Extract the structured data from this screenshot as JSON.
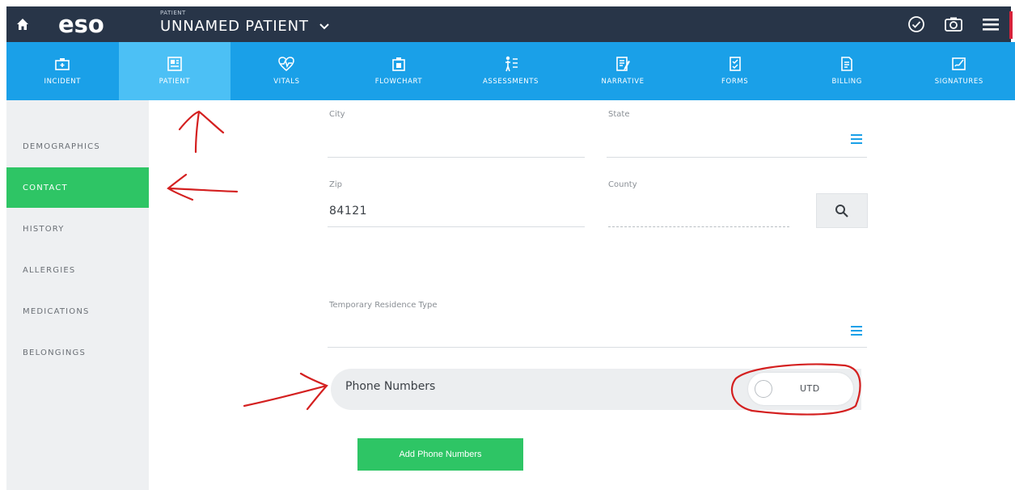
{
  "header": {
    "logo": "eso",
    "patient_small_label": "PATIENT",
    "patient_name": "UNNAMED PATIENT",
    "icons": [
      "home-icon",
      "check-circle-icon",
      "camera-icon",
      "menu-icon"
    ]
  },
  "nav": {
    "items": [
      {
        "label": "INCIDENT",
        "icon": "incident-icon"
      },
      {
        "label": "PATIENT",
        "icon": "patient-icon",
        "active": true
      },
      {
        "label": "VITALS",
        "icon": "vitals-icon"
      },
      {
        "label": "FLOWCHART",
        "icon": "flowchart-icon"
      },
      {
        "label": "ASSESSMENTS",
        "icon": "assessments-icon"
      },
      {
        "label": "NARRATIVE",
        "icon": "narrative-icon"
      },
      {
        "label": "FORMS",
        "icon": "forms-icon"
      },
      {
        "label": "BILLING",
        "icon": "billing-icon"
      },
      {
        "label": "SIGNATURES",
        "icon": "signatures-icon"
      }
    ]
  },
  "sidebar": {
    "items": [
      {
        "label": "DEMOGRAPHICS"
      },
      {
        "label": "CONTACT",
        "active": true
      },
      {
        "label": "HISTORY"
      },
      {
        "label": "ALLERGIES"
      },
      {
        "label": "MEDICATIONS"
      },
      {
        "label": "BELONGINGS"
      }
    ]
  },
  "form": {
    "city": {
      "label": "City",
      "value": ""
    },
    "state": {
      "label": "State",
      "value": ""
    },
    "zip": {
      "label": "Zip",
      "value": "84121"
    },
    "county": {
      "label": "County",
      "value": ""
    },
    "temp_residence": {
      "label": "Temporary Residence Type",
      "value": ""
    }
  },
  "phone": {
    "label": "Phone Numbers",
    "utd_label": "UTD",
    "add_button": "Add Phone Numbers"
  },
  "colors": {
    "topbar": "#283548",
    "navbar": "#1aa0e8",
    "nav_active": "#4cc0f5",
    "green": "#2ec565",
    "annotation_red": "#d42020"
  }
}
